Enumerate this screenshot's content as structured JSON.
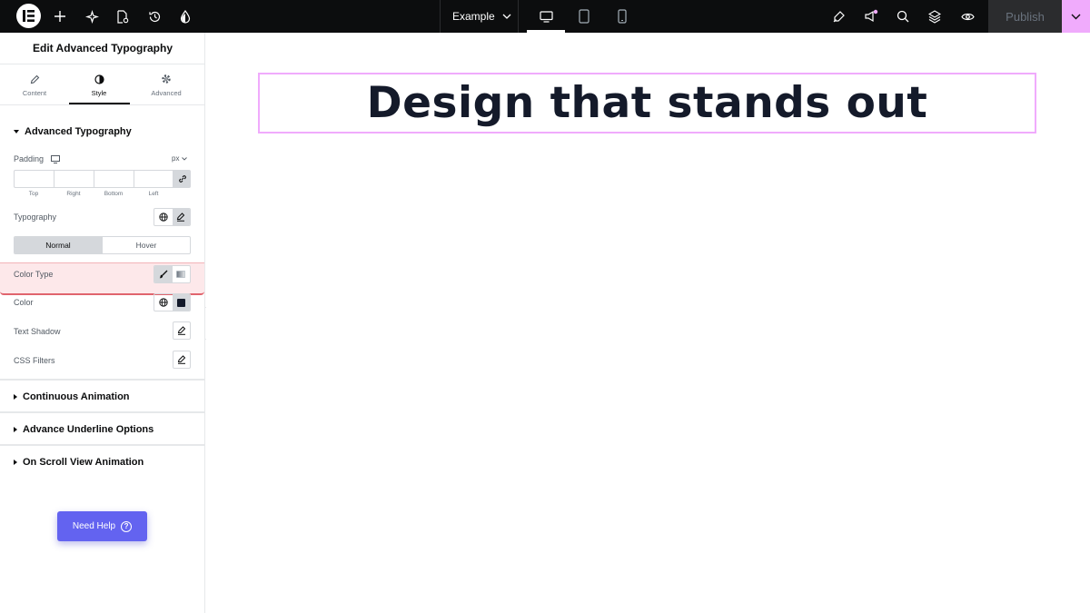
{
  "topbar": {
    "page_selector": "Example",
    "publish_label": "Publish",
    "icons": [
      "elementor-logo-icon",
      "add-icon",
      "ai-sparkle-icon",
      "page-settings-icon",
      "history-icon",
      "site-settings-icon",
      "desktop-icon",
      "tablet-icon",
      "mobile-icon",
      "integrations-icon",
      "whats-new-icon",
      "search-icon",
      "structure-layers-icon",
      "preview-eye-icon",
      "chevron-down-icon"
    ]
  },
  "panel": {
    "title": "Edit Advanced Typography",
    "tabs": [
      {
        "label": "Content",
        "icon": "pencil-icon"
      },
      {
        "label": "Style",
        "icon": "half-circle-icon"
      },
      {
        "label": "Advanced",
        "icon": "gear-icon"
      }
    ],
    "active_tab": "Style",
    "section_open": "Advanced Typography",
    "padding_label": "Padding",
    "padding_unit": "px",
    "dimension_labels": [
      "Top",
      "Right",
      "Bottom",
      "Left"
    ],
    "typography_label": "Typography",
    "state_tabs": [
      "Normal",
      "Hover"
    ],
    "state_selected": "Normal",
    "color_type_label": "Color Type",
    "color_label": "Color",
    "color_swatch": "#141a2a",
    "text_shadow_label": "Text Shadow",
    "css_filters_label": "CSS Filters",
    "collapsed_sections": [
      "Continuous Animation",
      "Advance Underline Options",
      "On Scroll View Animation"
    ],
    "help_label": "Need Help"
  },
  "canvas": {
    "heading": "Design that stands out",
    "heading_color": "#141a2a",
    "selection_color": "#f0abfc"
  }
}
